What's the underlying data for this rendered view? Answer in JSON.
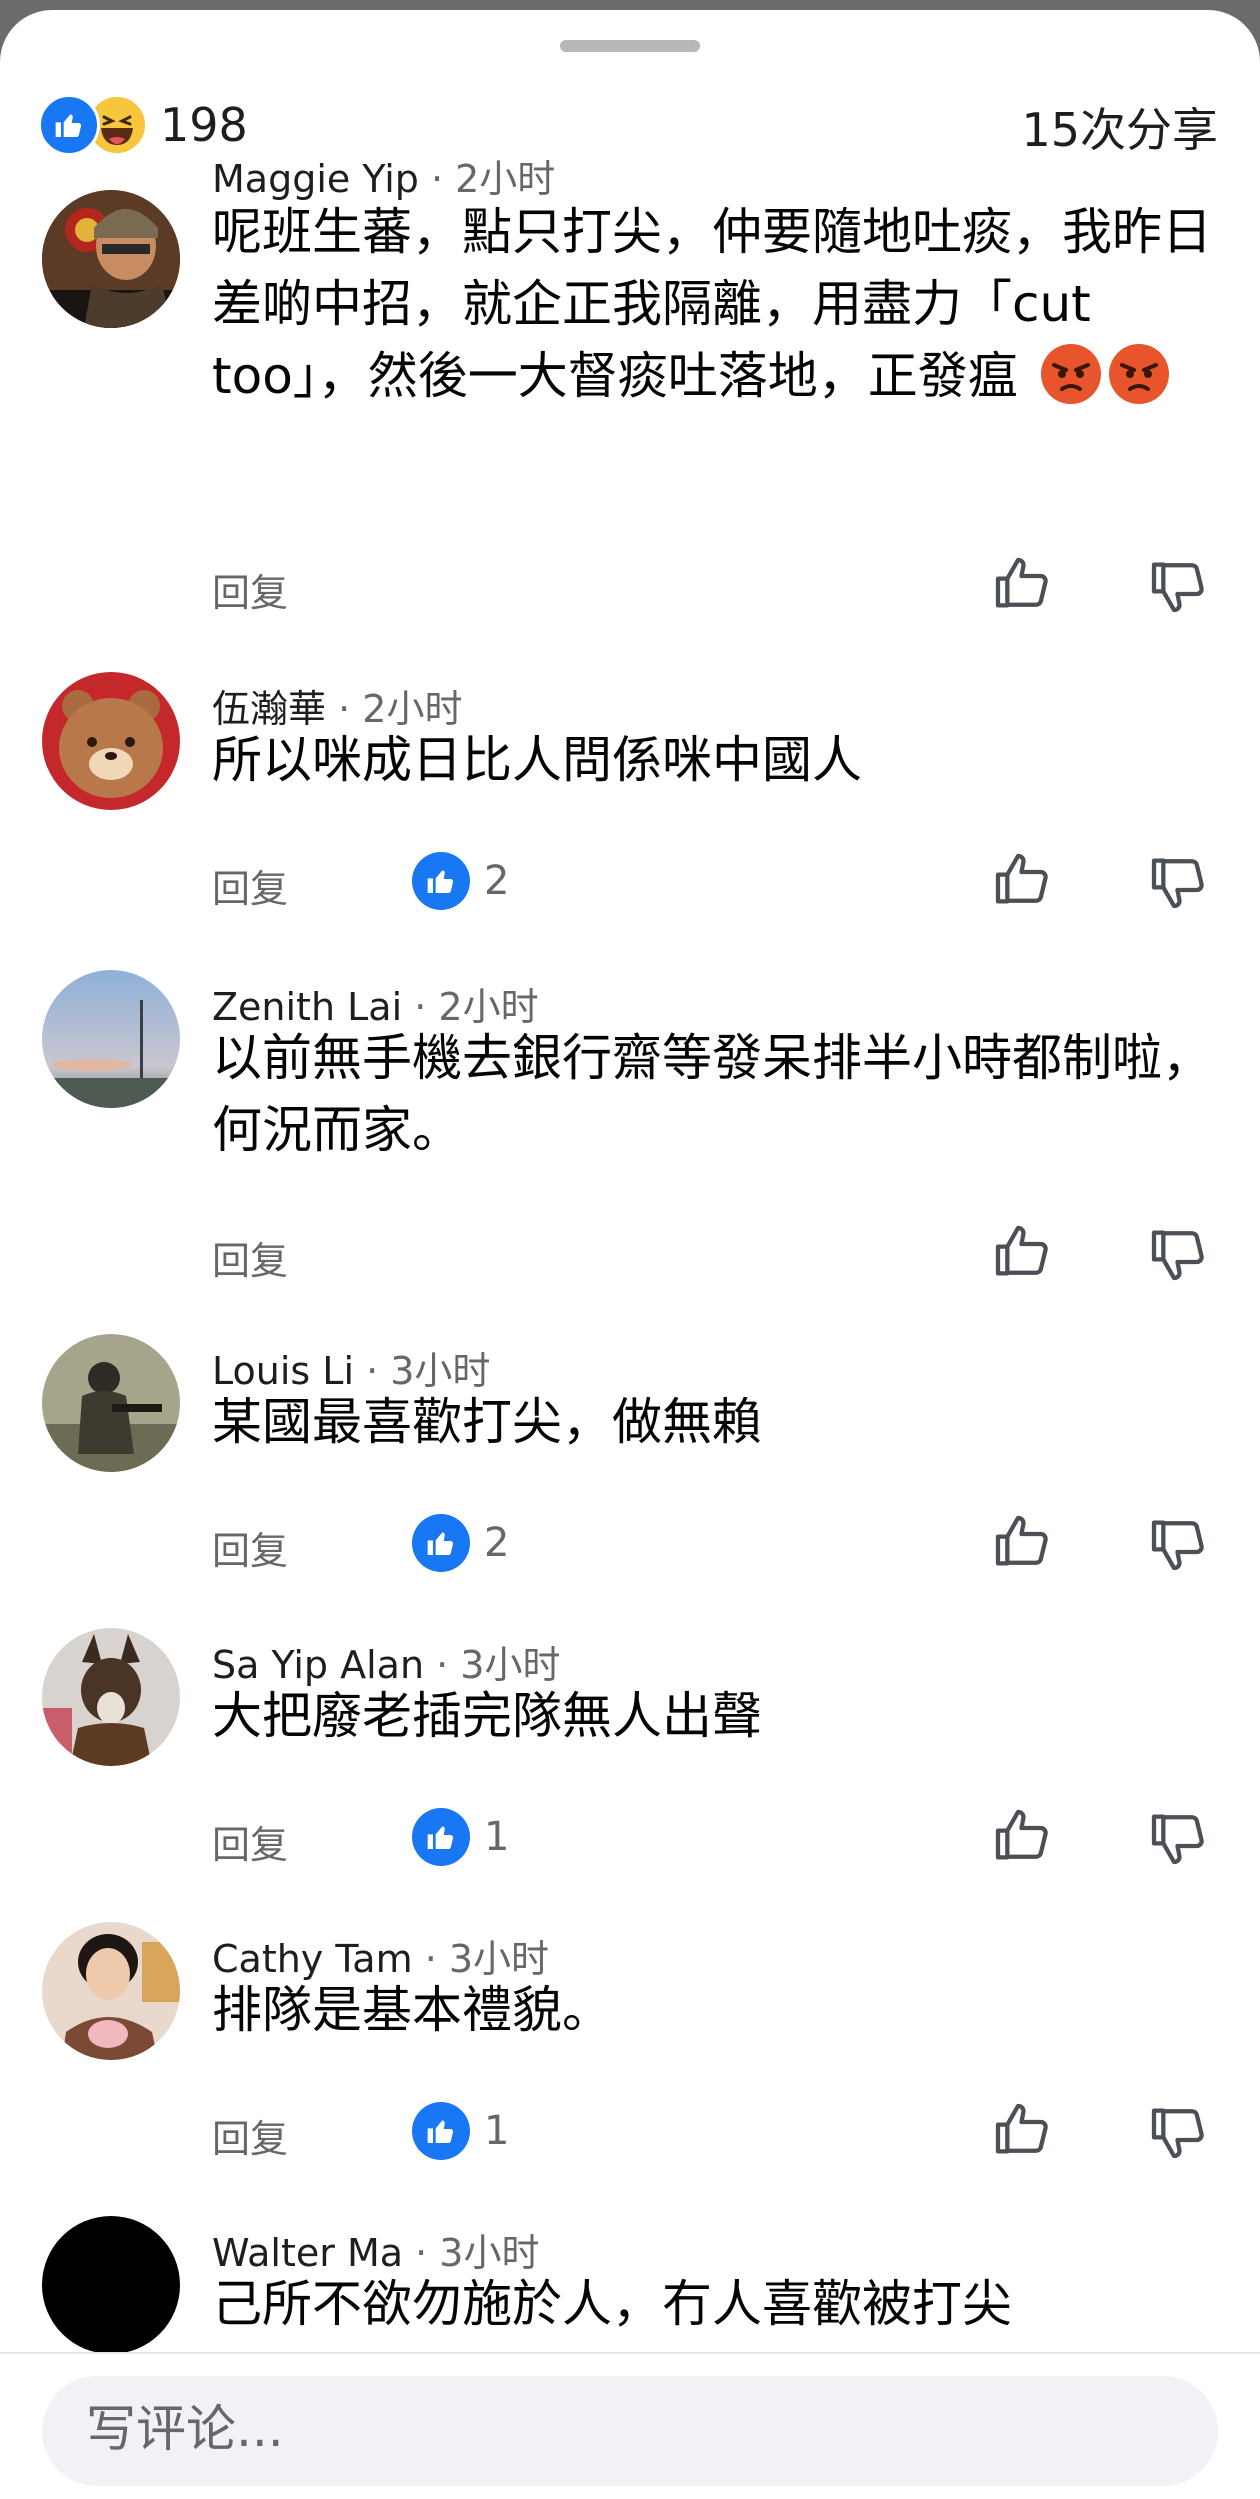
{
  "header": {
    "reaction_count": "198",
    "shares": "15次分享"
  },
  "comments": [
    {
      "name": "Maggie Yip",
      "time": "· 2小时",
      "text": "呢班生蕃，點只打尖，仲要隨地吐痰，我昨日差啲中招，就企正我隔離，用盡力「cut too」，然後一大督痰吐落地，正發瘟",
      "reply_label": "回复",
      "likes": ""
    },
    {
      "name": "伍瀚華",
      "time": "· 2小时",
      "text": "所以咪成日比人問係咪中國人",
      "reply_label": "回复",
      "likes": "2"
    },
    {
      "name": "Zenith Lai",
      "time": "· 2小时",
      "text": "以前無手機去銀行齋等發呆排半小時都制啦，何況而家。",
      "reply_label": "回复",
      "likes": ""
    },
    {
      "name": "Louis Li",
      "time": "· 3小时",
      "text": "某國最喜歡打尖，做無賴",
      "reply_label": "回复",
      "likes": "2"
    },
    {
      "name": "Sa Yip Alan",
      "time": "· 3小时",
      "text": "大把廢老插完隊無人出聲",
      "reply_label": "回复",
      "likes": "1"
    },
    {
      "name": "Cathy Tam",
      "time": "· 3小时",
      "text": "排隊是基本禮貌。",
      "reply_label": "回复",
      "likes": "1"
    },
    {
      "name": "Walter Ma",
      "time": "· 3小时",
      "text": "己所不欲勿施於人，冇人喜歡被打尖",
      "reply_label": "",
      "likes": ""
    }
  ],
  "composer": {
    "placeholder": "写评论..."
  },
  "colors": {
    "accent": "#1877f2",
    "muted_text": "#65676b",
    "composer_bg": "#f0f2f5"
  },
  "icons": {
    "like": "thumbs-up-icon",
    "dislike": "thumbs-down-icon",
    "angry": "angry-emoji"
  }
}
